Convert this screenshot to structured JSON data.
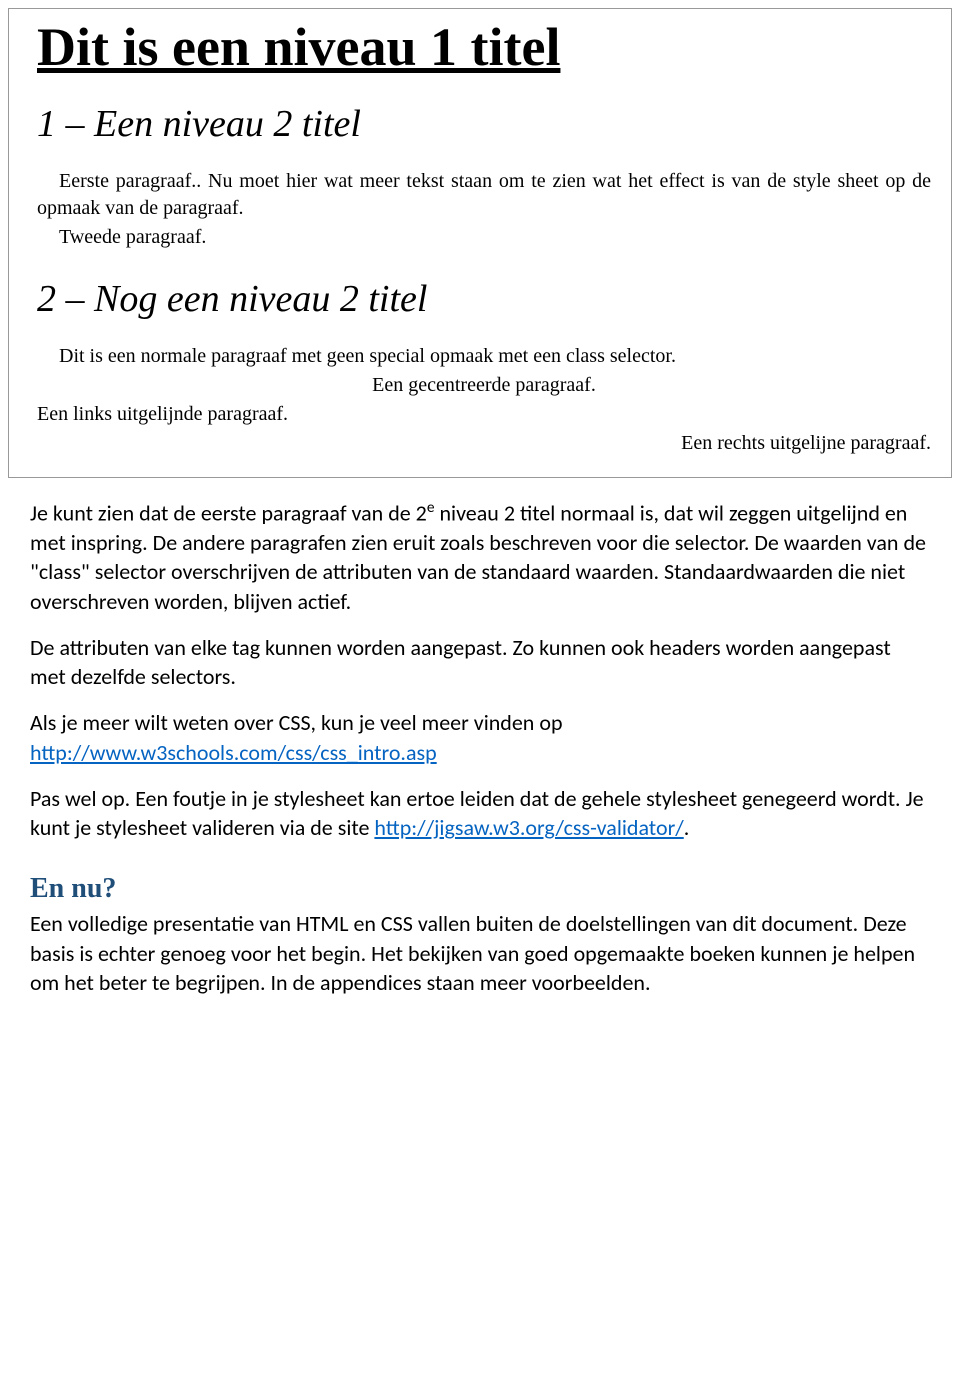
{
  "framed": {
    "h1": "Dit is een niveau 1 titel",
    "h2a": "1 – Een niveau 2 titel",
    "p1": "Eerste paragraaf.. Nu moet hier wat meer tekst staan om te zien wat het effect is van de style sheet op de opmaak van de paragraaf.",
    "p2": "Tweede paragraaf.",
    "h2b": "2 – Nog een niveau 2 titel",
    "p3": "Dit is een normale paragraaf met geen special opmaak met een class selector.",
    "p4": "Een gecentreerde paragraaf.",
    "p5": "Een links uitgelijnde paragraaf.",
    "p6": "Een rechts uitgelijne paragraaf."
  },
  "body": {
    "para1_pre": "Je kunt zien dat de eerste paragraaf van de 2",
    "para1_sup": "e",
    "para1_post": " niveau 2 titel normaal is, dat wil zeggen uitgelijnd en met inspring. De andere paragrafen zien eruit zoals beschreven voor die selector. De waarden van de \"class\" selector overschrijven de attributen van de standaard waarden. Standaardwaarden die niet overschreven worden, blijven actief.",
    "para2": "De attributen van elke tag kunnen worden aangepast. Zo kunnen ook headers worden aangepast met dezelfde selectors.",
    "para3_pre": "Als je meer wilt weten over CSS, kun je veel meer vinden op ",
    "link1": "http://www.w3schools.com/css/css_intro.asp",
    "para4_pre": "Pas wel op. Een foutje in je stylesheet kan ertoe leiden dat de gehele stylesheet genegeerd wordt. Je kunt je stylesheet valideren via de site ",
    "link2": "http://jigsaw.w3.org/css-validator/",
    "para4_post": ".",
    "heading": "En nu?",
    "para5": "Een volledige presentatie van HTML en CSS vallen buiten de doelstellingen van dit document. Deze basis is echter genoeg voor het begin. Het bekijken van goed opgemaakte boeken kunnen je helpen om het beter te begrijpen. In de appendices staan meer voorbeelden."
  }
}
